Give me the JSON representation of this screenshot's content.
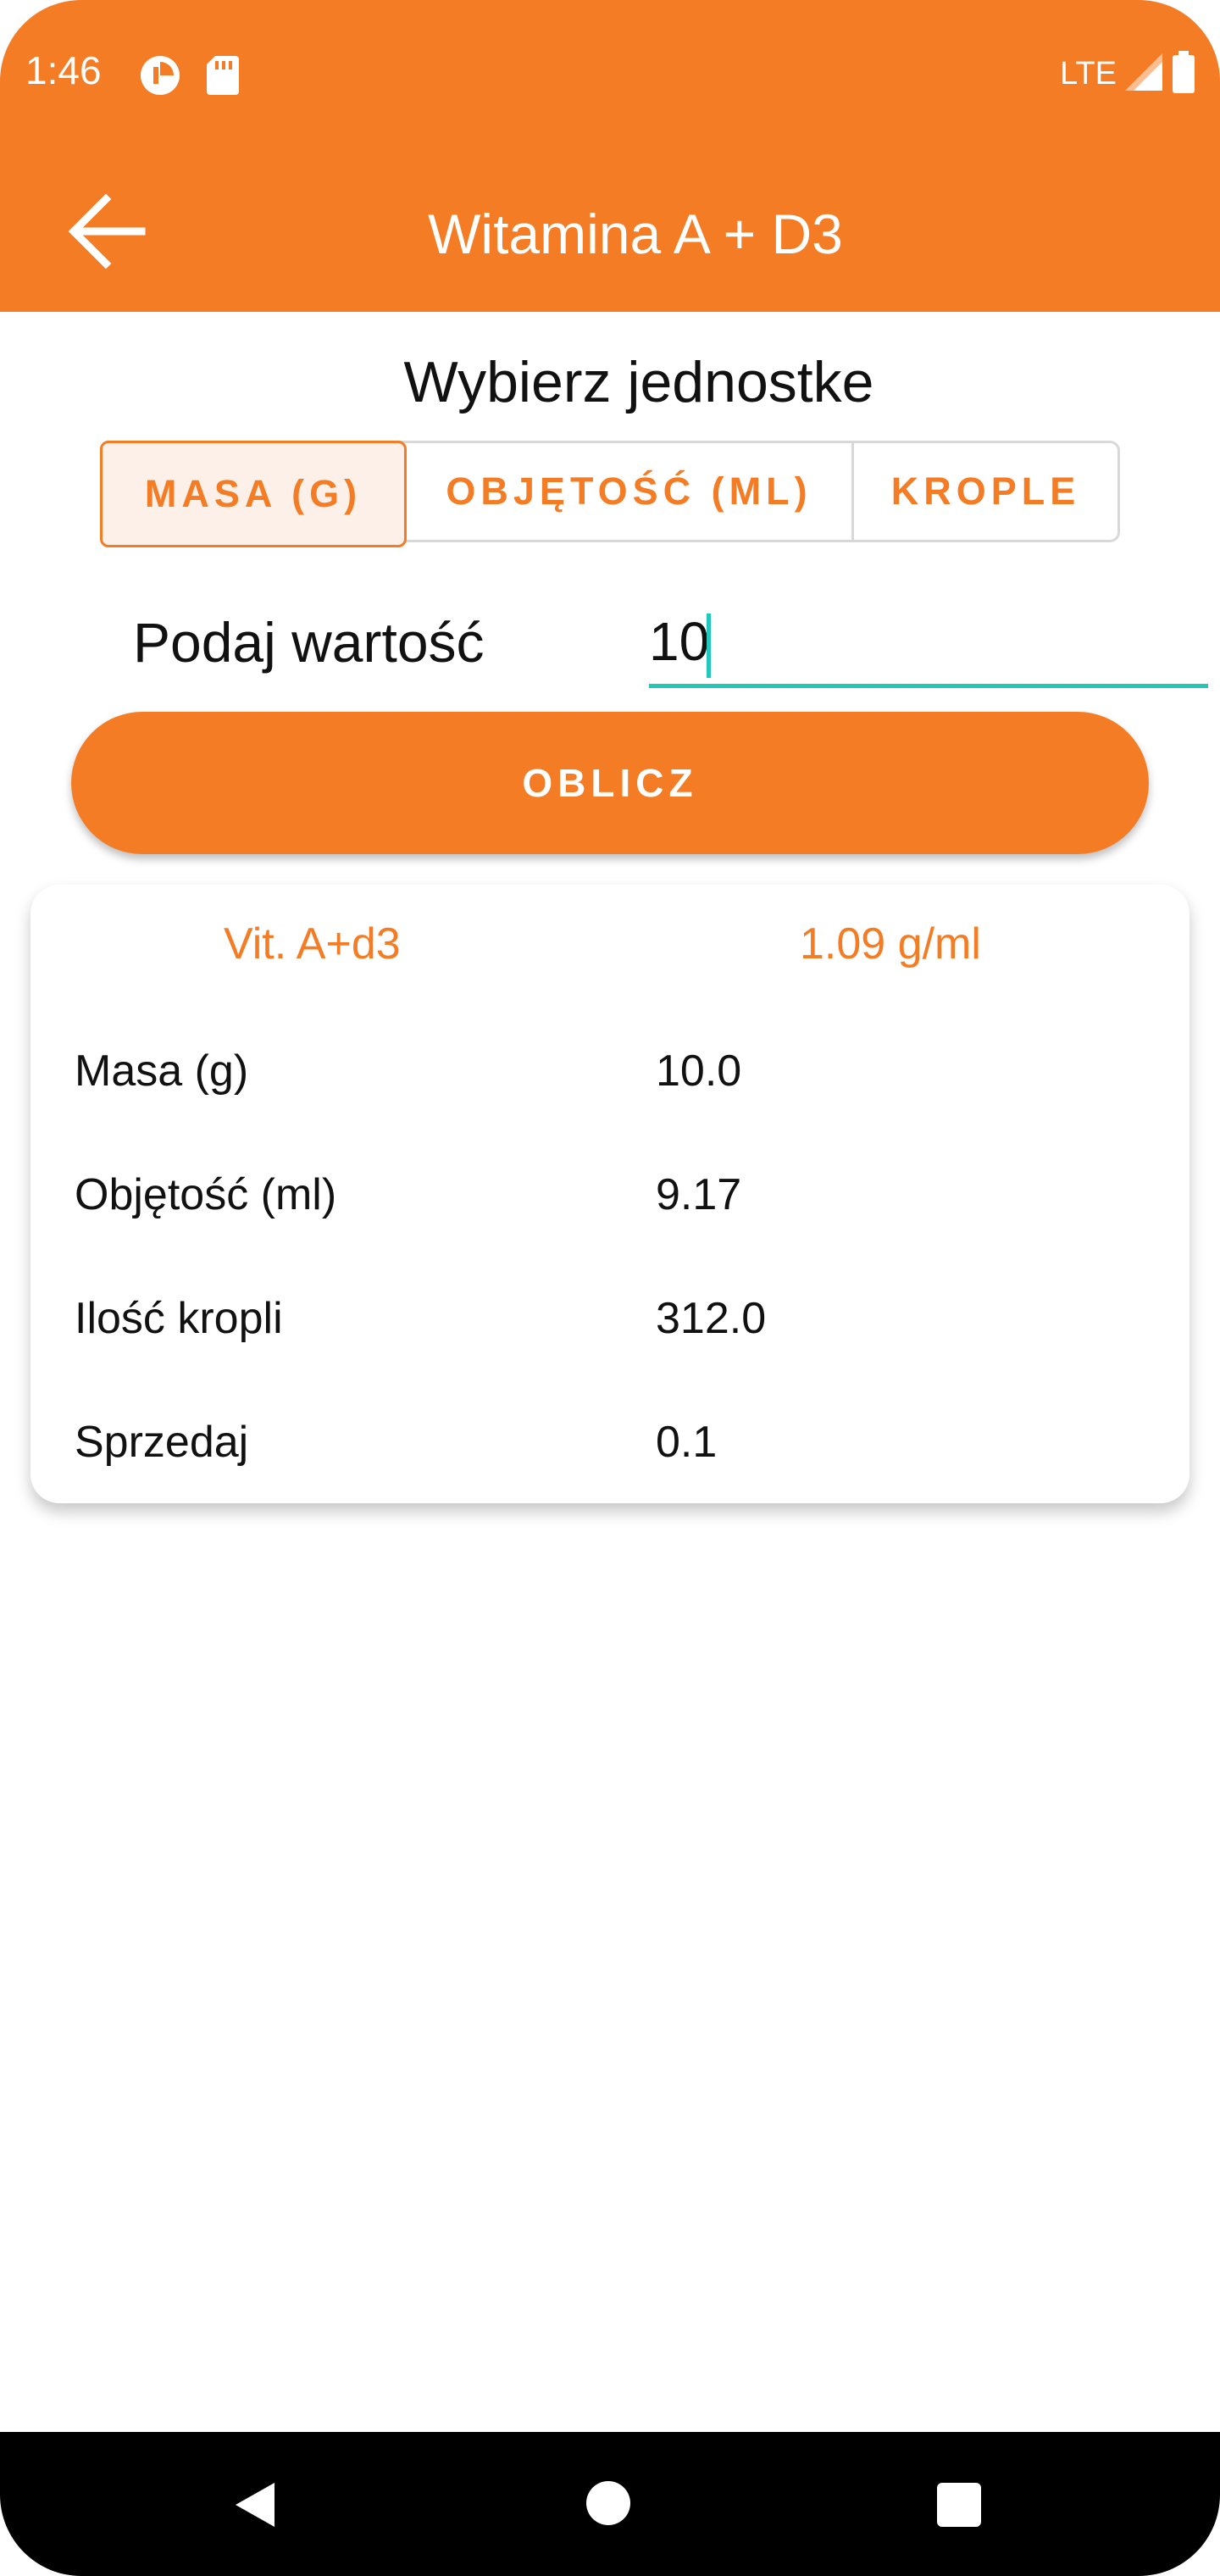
{
  "status_bar": {
    "time": "1:46",
    "network": "LTE",
    "icons": [
      "data-saver-icon",
      "sd-card-icon",
      "signal-icon",
      "battery-icon"
    ]
  },
  "app_bar": {
    "title": "Witamina A + D3",
    "back_icon": "arrow-back-icon"
  },
  "unit_selector": {
    "title": "Wybierz jednostke",
    "options": [
      "MASA (G)",
      "OBJĘTOŚĆ (ML)",
      "KROPLE"
    ],
    "selected": "MASA (G)"
  },
  "input": {
    "label": "Podaj wartość",
    "value": "10"
  },
  "calculate_button": {
    "label": "OBLICZ"
  },
  "result_card": {
    "product": "Vit. A+d3",
    "density": "1.09 g/ml",
    "rows": [
      {
        "label": "Masa (g)",
        "value": "10.0"
      },
      {
        "label": "Objętość (ml)",
        "value": "9.17"
      },
      {
        "label": "Ilość kropli",
        "value": "312.0"
      },
      {
        "label": "Sprzedaj",
        "value": "0.1"
      }
    ]
  },
  "nav_bar": {
    "icons": [
      "nav-back-icon",
      "nav-home-icon",
      "nav-recents-icon"
    ]
  },
  "colors": {
    "accent": "#f47c24",
    "input_underline": "#22c8b8",
    "nav_bar": "#000000"
  }
}
